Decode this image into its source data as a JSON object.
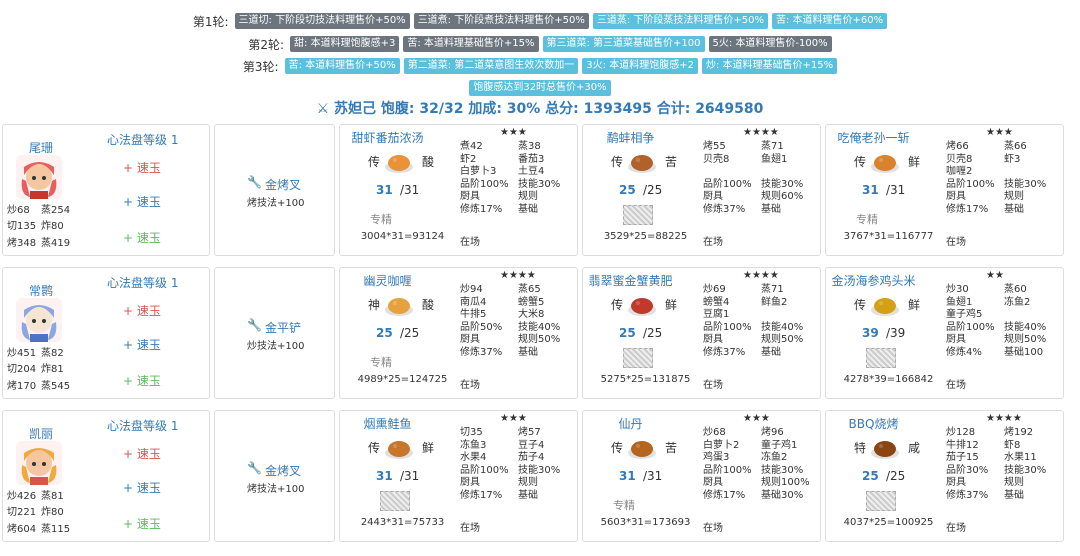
{
  "rounds": [
    {
      "label": "第1轮:",
      "tags": [
        {
          "text": "三道切: 下阶段切技法料理售价+50%",
          "color": "gray"
        },
        {
          "text": "三道煮: 下阶段煮技法料理售价+50%",
          "color": "gray"
        },
        {
          "text": "三道蒸: 下阶段蒸技法料理售价+50%",
          "color": "blue"
        },
        {
          "text": "苦: 本道料理售价+60%",
          "color": "blue"
        }
      ]
    },
    {
      "label": "第2轮:",
      "tags": [
        {
          "text": "甜: 本道料理饱腹感+3",
          "color": "gray"
        },
        {
          "text": "苦: 本道料理基础售价+15%",
          "color": "gray"
        },
        {
          "text": "第三道菜: 第三道菜基础售价+100",
          "color": "blue"
        },
        {
          "text": "5火: 本道料理售价-100%",
          "color": "gray"
        }
      ]
    },
    {
      "label": "第3轮:",
      "tags": [
        {
          "text": "苦: 本道料理售价+50%",
          "color": "blue"
        },
        {
          "text": "第二道菜: 第二道菜意图生效次数加一",
          "color": "blue"
        },
        {
          "text": "3火: 本道料理饱腹感+2",
          "color": "blue"
        },
        {
          "text": "炒: 本道料理基础售价+15%",
          "color": "blue"
        }
      ]
    },
    {
      "label": "",
      "tags": [
        {
          "text": "饱腹感达到32时总售价+30%",
          "color": "blue"
        }
      ]
    }
  ],
  "summary": "苏妲己 饱腹: 32/32 加成: 30% 总分: 1393495 合计: 2649580",
  "chefs": [
    {
      "name": "尾珊",
      "skill_title": "心法盘等级 1",
      "jades": [
        "+ 速玉",
        "+ 速玉",
        "+ 速玉"
      ],
      "stats": [
        [
          "炒68",
          "蒸254"
        ],
        [
          "切135",
          "炸80"
        ],
        [
          "烤348",
          "蒸419"
        ]
      ],
      "equip": {
        "name": "金烤叉",
        "desc": "烤技法+100"
      },
      "dishes": [
        {
          "name": "甜虾番茄浓汤",
          "stars": "★★★",
          "rarity": "传",
          "cond": "酸",
          "qty": "31",
          "qmax": "/31",
          "mark": "专精",
          "grid": [
            [
              "煮42",
              "蒸38"
            ],
            [
              "虾2",
              "番茄3"
            ],
            [
              "白萝卜3",
              "土豆4"
            ],
            [
              "品阶100%",
              "技能30%"
            ],
            [
              "厨具",
              "规则"
            ],
            [
              "修炼17%",
              "基础"
            ]
          ],
          "status": "在场",
          "total": "3004*31=93124",
          "icon_color": "#e8923a"
        },
        {
          "name": "鹬蚌相争",
          "stars": "★★★★",
          "rarity": "传",
          "cond": "苦",
          "qty": "25",
          "qmax": "/25",
          "mark": "",
          "grid": [
            [
              "烤55",
              "蒸71"
            ],
            [
              "贝壳8",
              "鱼翅1"
            ],
            [
              "",
              ""
            ],
            [
              "品阶100%",
              "技能30%"
            ],
            [
              "厨具",
              "规则60%"
            ],
            [
              "修炼37%",
              "基础"
            ]
          ],
          "status": "在场",
          "total": "3529*25=88225",
          "icon_color": "#b0622a"
        },
        {
          "name": "吃俺老孙一斩",
          "stars": "★★★",
          "rarity": "传",
          "cond": "鲜",
          "qty": "31",
          "qmax": "/31",
          "mark": "专精",
          "grid": [
            [
              "烤66",
              "蒸66"
            ],
            [
              "贝壳8",
              "虾3"
            ],
            [
              "咖喱2",
              ""
            ],
            [
              "品阶100%",
              "技能30%"
            ],
            [
              "厨具",
              "规则"
            ],
            [
              "修炼17%",
              "基础"
            ]
          ],
          "status": "在场",
          "total": "3767*31=116777",
          "icon_color": "#d9822b"
        }
      ]
    },
    {
      "name": "常鹮",
      "skill_title": "心法盘等级 1",
      "jades": [
        "+ 速玉",
        "+ 速玉",
        "+ 速玉"
      ],
      "stats": [
        [
          "炒451",
          "蒸82"
        ],
        [
          "切204",
          "炸81"
        ],
        [
          "烤170",
          "蒸545"
        ]
      ],
      "equip": {
        "name": "金平铲",
        "desc": "炒技法+100"
      },
      "dishes": [
        {
          "name": "幽灵咖喱",
          "stars": "★★★★",
          "rarity": "神",
          "cond": "酸",
          "qty": "25",
          "qmax": "/25",
          "mark": "专精",
          "grid": [
            [
              "炒94",
              "蒸65"
            ],
            [
              "南瓜4",
              "螃蟹5"
            ],
            [
              "牛排5",
              "大米8"
            ],
            [
              "品阶50%",
              "技能40%"
            ],
            [
              "厨具",
              "规则50%"
            ],
            [
              "修炼37%",
              "基础"
            ]
          ],
          "status": "在场",
          "total": "4989*25=124725",
          "icon_color": "#e6a23c"
        },
        {
          "name": "翡翠蜜金蟹黄肥",
          "stars": "★★★★",
          "rarity": "传",
          "cond": "鲜",
          "qty": "25",
          "qmax": "/25",
          "mark": "",
          "grid": [
            [
              "炒69",
              "蒸71"
            ],
            [
              "螃蟹4",
              "鲜鱼2"
            ],
            [
              "豆腐1",
              ""
            ],
            [
              "品阶100%",
              "技能40%"
            ],
            [
              "厨具",
              "规则50%"
            ],
            [
              "修炼37%",
              "基础"
            ]
          ],
          "status": "在场",
          "total": "5275*25=131875",
          "icon_color": "#c0392b"
        },
        {
          "name": "金汤海参鸡头米",
          "stars": "★★",
          "rarity": "传",
          "cond": "鲜",
          "qty": "39",
          "qmax": "/39",
          "mark": "",
          "grid": [
            [
              "炒30",
              "蒸60"
            ],
            [
              "鱼翅1",
              "冻鱼2"
            ],
            [
              "童子鸡5",
              ""
            ],
            [
              "品阶100%",
              "技能40%"
            ],
            [
              "厨具",
              "规则50%"
            ],
            [
              "修炼4%",
              "基础100"
            ]
          ],
          "status": "在场",
          "total": "4278*39=166842",
          "icon_color": "#d4a017"
        }
      ]
    },
    {
      "name": "凯丽",
      "skill_title": "心法盘等级 1",
      "jades": [
        "+ 速玉",
        "+ 速玉",
        "+ 速玉"
      ],
      "stats": [
        [
          "炒426",
          "蒸81"
        ],
        [
          "切221",
          "炸80"
        ],
        [
          "烤604",
          "蒸115"
        ]
      ],
      "equip": {
        "name": "金烤叉",
        "desc": "烤技法+100"
      },
      "dishes": [
        {
          "name": "烟熏鲑鱼",
          "stars": "★★★",
          "rarity": "传",
          "cond": "鲜",
          "qty": "31",
          "qmax": "/31",
          "mark": "",
          "grid": [
            [
              "切35",
              "烤57"
            ],
            [
              "冻鱼3",
              "豆子4"
            ],
            [
              "水果4",
              "茄子4"
            ],
            [
              "品阶100%",
              "技能30%"
            ],
            [
              "厨具",
              "规则"
            ],
            [
              "修炼17%",
              "基础"
            ]
          ],
          "status": "在场",
          "total": "2443*31=75733",
          "icon_color": "#c8762a"
        },
        {
          "name": "仙丹",
          "stars": "★★★",
          "rarity": "传",
          "cond": "苦",
          "qty": "31",
          "qmax": "/31",
          "mark": "专精",
          "grid": [
            [
              "炒68",
              "烤96"
            ],
            [
              "白萝卜2",
              "童子鸡1"
            ],
            [
              "鸡蛋3",
              "冻鱼2"
            ],
            [
              "品阶100%",
              "技能30%"
            ],
            [
              "厨具",
              "规则100%"
            ],
            [
              "修炼17%",
              "基础30%"
            ]
          ],
          "status": "在场",
          "total": "5603*31=173693",
          "icon_color": "#b5651d"
        },
        {
          "name": "BBQ烧烤",
          "stars": "★★★★",
          "rarity": "特",
          "cond": "咸",
          "qty": "25",
          "qmax": "/25",
          "mark": "",
          "grid": [
            [
              "炒128",
              "烤192"
            ],
            [
              "牛排12",
              "虾8"
            ],
            [
              "茄子15",
              "水果11"
            ],
            [
              "品阶30%",
              "技能30%"
            ],
            [
              "厨具",
              "规则"
            ],
            [
              "修炼37%",
              "基础"
            ]
          ],
          "status": "在场",
          "total": "4037*25=100925",
          "icon_color": "#8b4513"
        }
      ]
    }
  ],
  "colors": {
    "accent": "#337ab7",
    "tag_gray": "#6c757d",
    "tag_blue": "#5bc0de",
    "red": "#d9534f",
    "green": "#5cb85c",
    "gold": "#c8961e"
  }
}
